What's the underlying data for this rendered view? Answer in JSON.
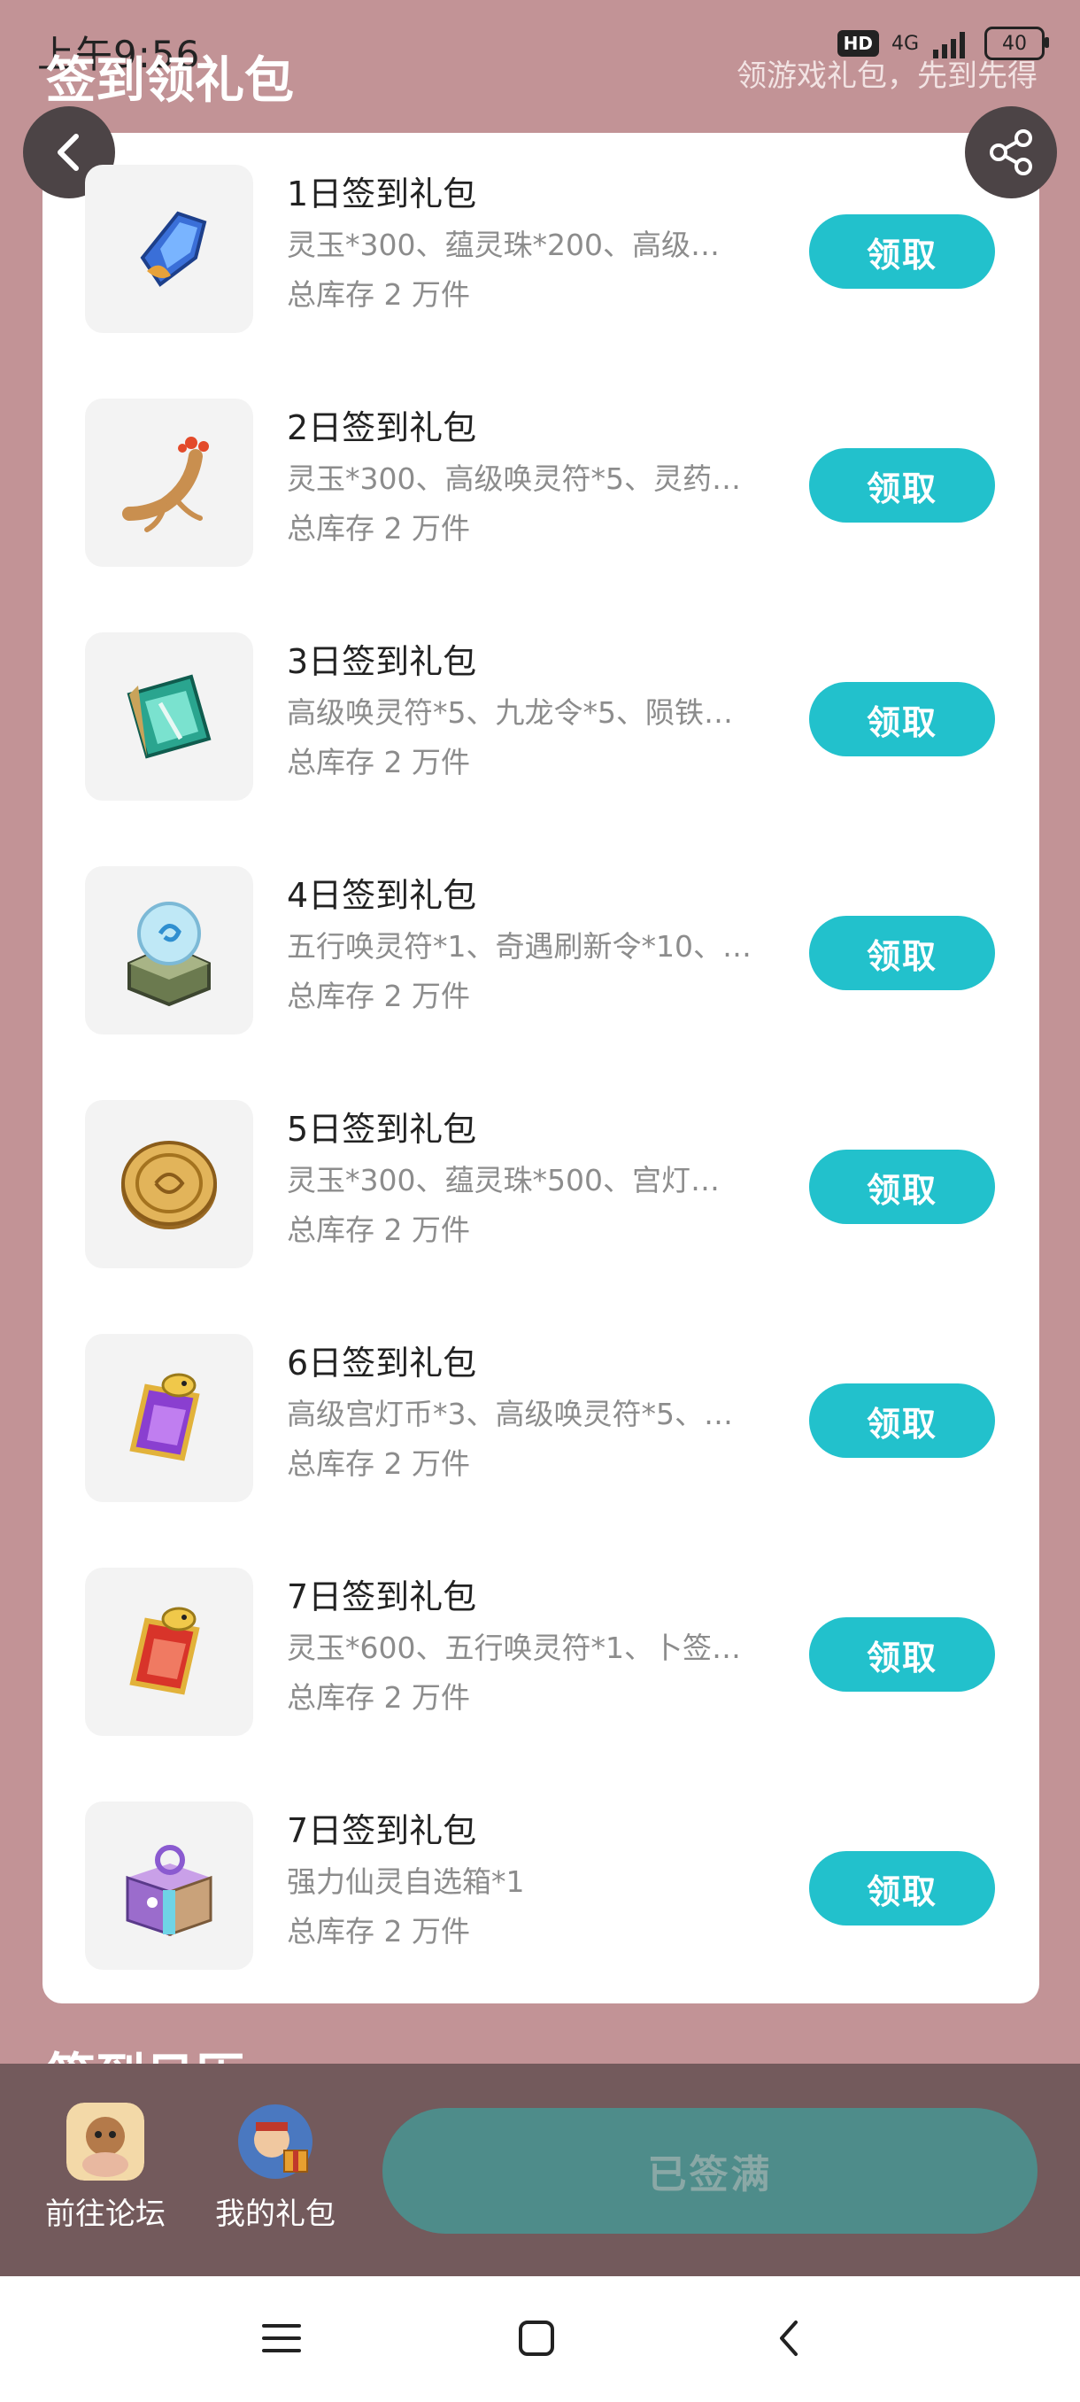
{
  "status_bar": {
    "time": "上午9:56",
    "network": "4G",
    "hd": "HD",
    "battery": "40"
  },
  "header": {
    "title": "签到领礼包",
    "subtitle": "领游戏礼包，先到先得"
  },
  "gifts": [
    {
      "name": "1日签到礼包",
      "desc": "灵玉*300、蕴灵珠*200、高级…",
      "stock": "总库存 2 万件",
      "button": "领取",
      "icon": "blue-crystal-icon"
    },
    {
      "name": "2日签到礼包",
      "desc": "灵玉*300、高级唤灵符*5、灵药…",
      "stock": "总库存 2 万件",
      "button": "领取",
      "icon": "ginseng-root-icon"
    },
    {
      "name": "3日签到礼包",
      "desc": "高级唤灵符*5、九龙令*5、陨铁…",
      "stock": "总库存 2 万件",
      "button": "领取",
      "icon": "jade-talisman-icon"
    },
    {
      "name": "4日签到礼包",
      "desc": "五行唤灵符*1、奇遇刷新令*10、…",
      "stock": "总库存 2 万件",
      "button": "领取",
      "icon": "spirit-orb-icon"
    },
    {
      "name": "5日签到礼包",
      "desc": "灵玉*300、蕴灵珠*500、宫灯…",
      "stock": "总库存 2 万件",
      "button": "领取",
      "icon": "gold-coin-icon"
    },
    {
      "name": "6日签到礼包",
      "desc": "高级宫灯币*3、高级唤灵符*5、…",
      "stock": "总库存 2 万件",
      "button": "领取",
      "icon": "purple-scroll-icon"
    },
    {
      "name": "7日签到礼包",
      "desc": "灵玉*600、五行唤灵符*1、卜签…",
      "stock": "总库存 2 万件",
      "button": "领取",
      "icon": "red-scroll-icon"
    },
    {
      "name": "7日签到礼包",
      "desc": "强力仙灵自选箱*1",
      "stock": "总库存 2 万件",
      "button": "领取",
      "icon": "gift-box-icon"
    }
  ],
  "bottom": {
    "forum_label": "前往论坛",
    "my_gifts_label": "我的礼包",
    "signed_label": "已签满",
    "hidden_heading": "签到日历"
  },
  "colors": {
    "accent": "#22c1cc",
    "background": "#c29396",
    "bottom_bar": "#735a5c",
    "signed_button": "#4e8c8a"
  }
}
